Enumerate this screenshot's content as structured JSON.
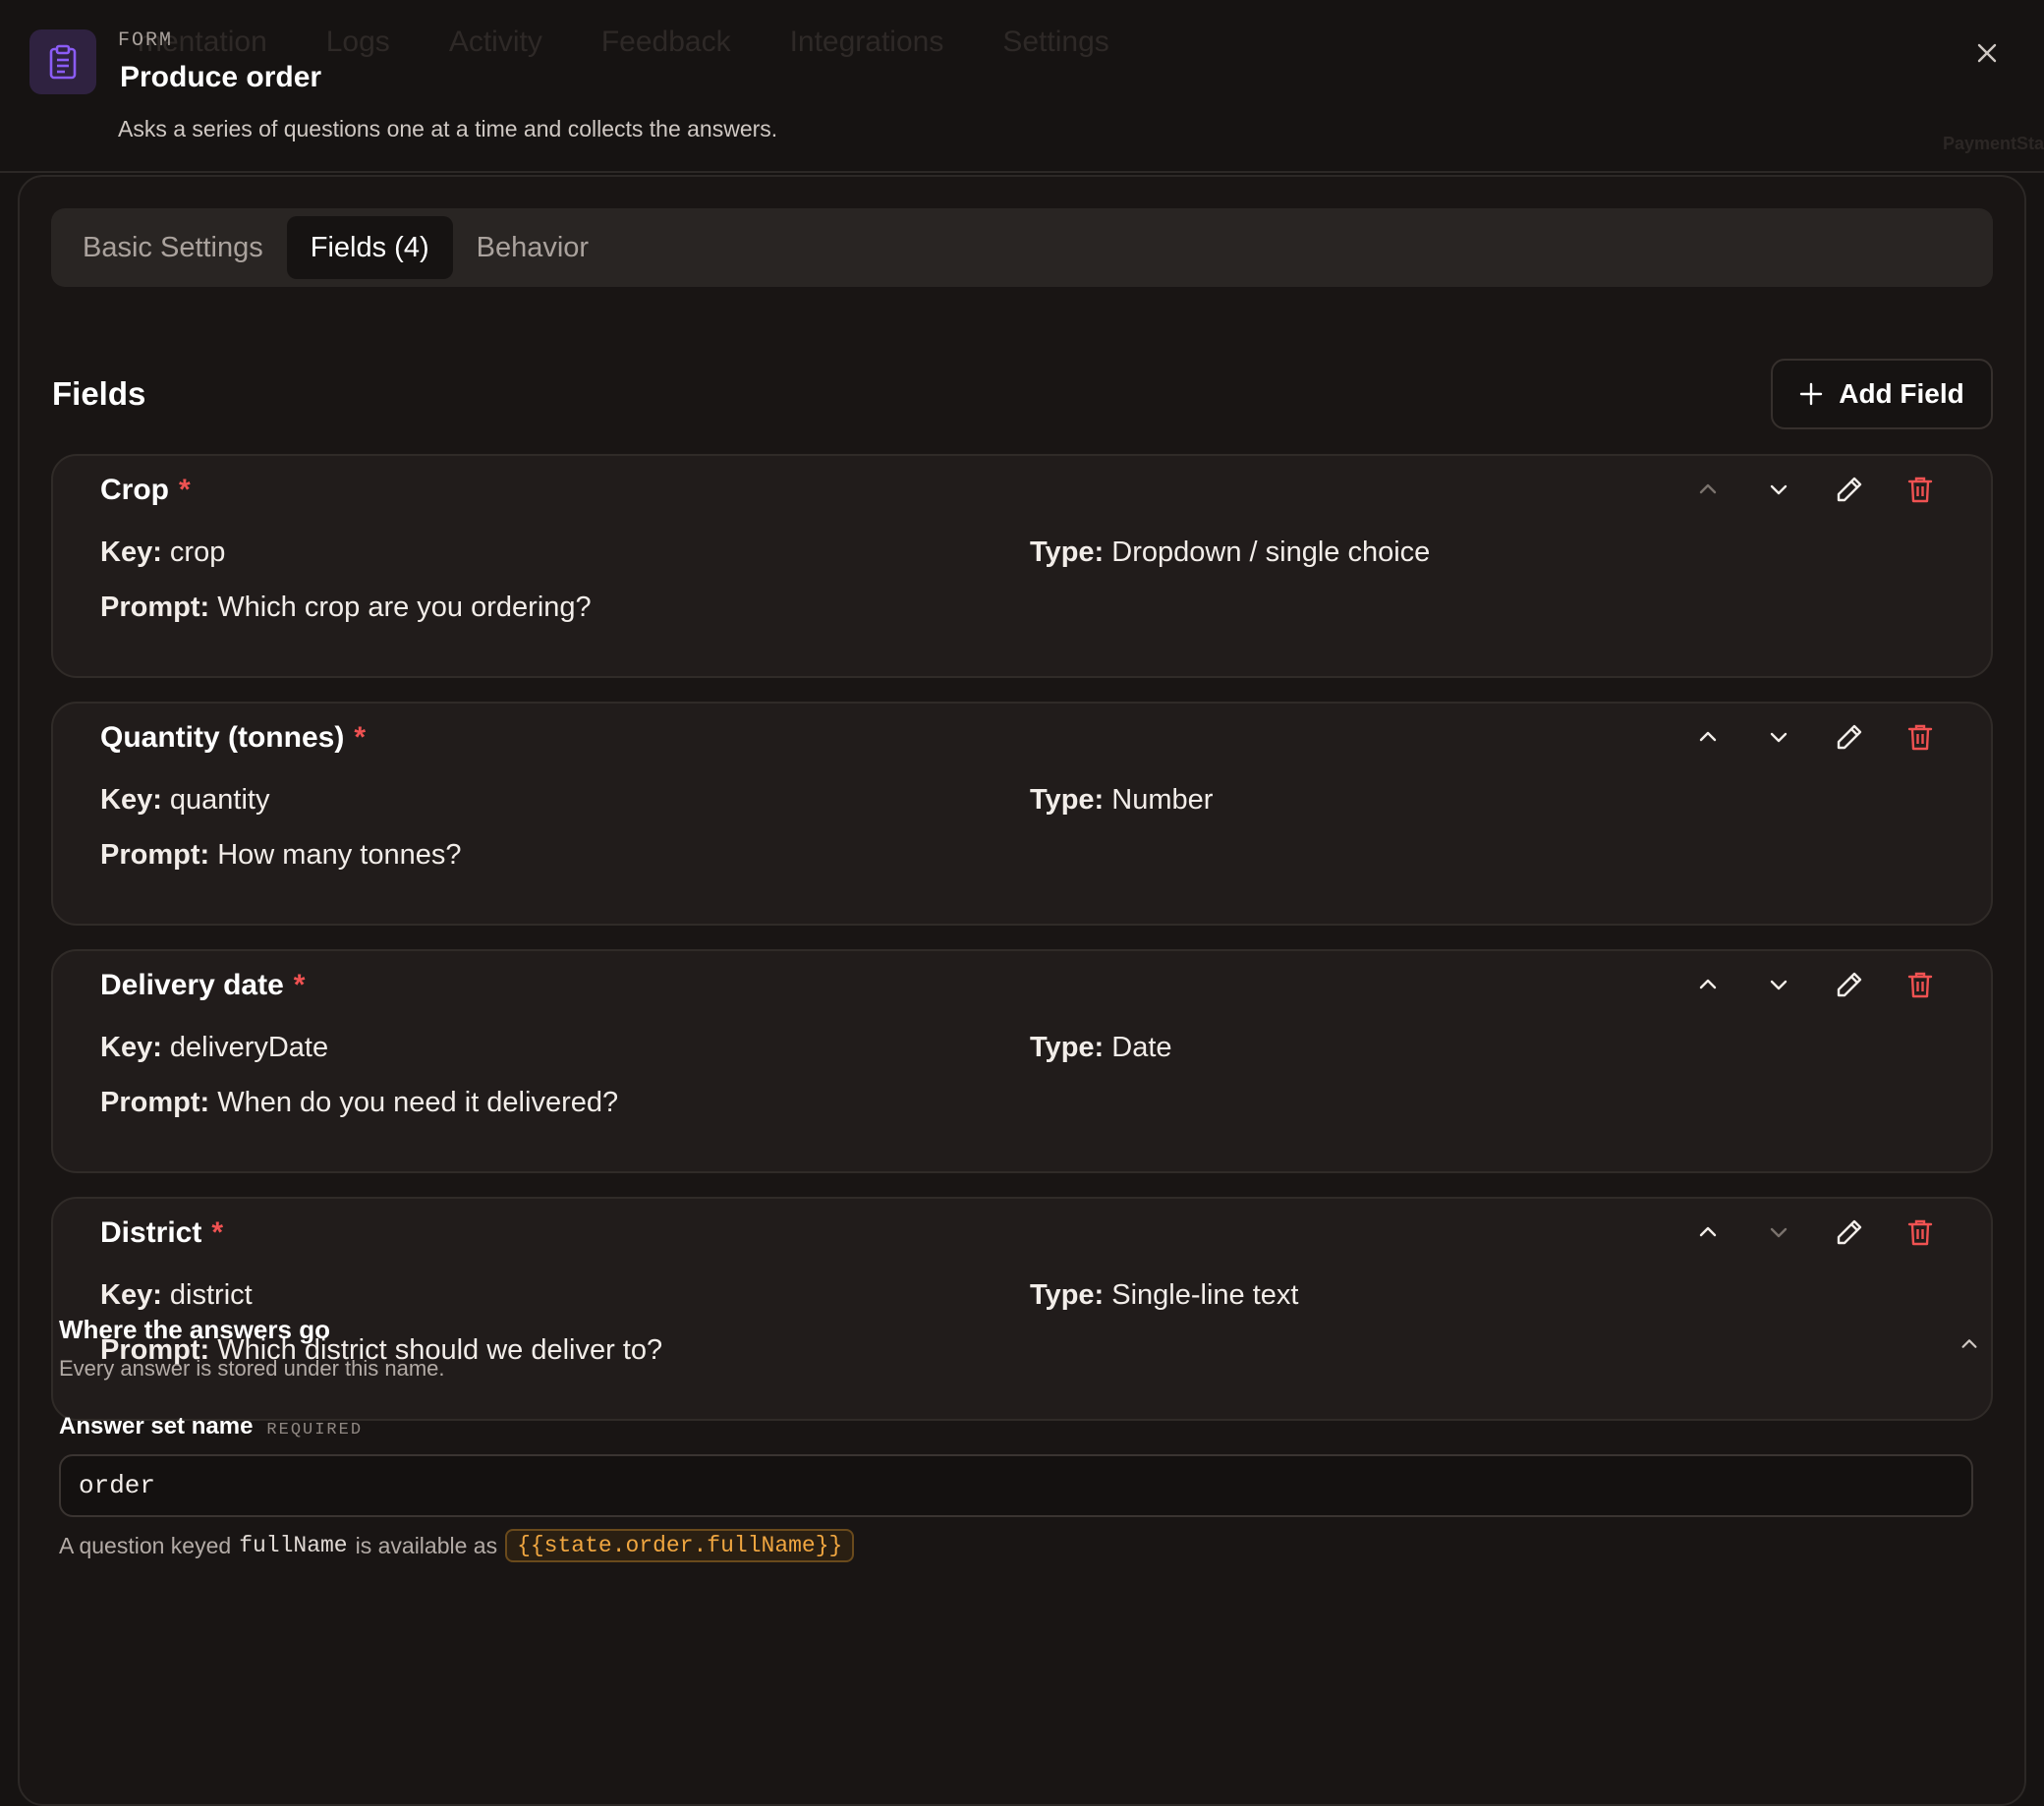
{
  "background_nav": {
    "items": [
      "mentation",
      "Logs",
      "Activity",
      "Feedback",
      "Integrations",
      "Settings"
    ],
    "right_text": "PaymentSta"
  },
  "header": {
    "kind": "FORM",
    "title": "Produce order",
    "description": "Asks a series of questions one at a time and collects the answers.",
    "icon": "clipboard-icon"
  },
  "tabs": [
    {
      "label": "Basic Settings",
      "active": false
    },
    {
      "label": "Fields (4)",
      "active": true
    },
    {
      "label": "Behavior",
      "active": false
    }
  ],
  "fields_section": {
    "title": "Fields",
    "add_button_label": "Add Field",
    "key_label": "Key:",
    "type_label": "Type:",
    "prompt_label": "Prompt:",
    "required_marker": "*"
  },
  "fields": [
    {
      "label": "Crop",
      "key": "crop",
      "type": "Dropdown / single choice",
      "prompt": "Which crop are you ordering?",
      "up_enabled": false,
      "down_enabled": true
    },
    {
      "label": "Quantity (tonnes)",
      "key": "quantity",
      "type": "Number",
      "prompt": "How many tonnes?",
      "up_enabled": true,
      "down_enabled": true
    },
    {
      "label": "Delivery date",
      "key": "deliveryDate",
      "type": "Date",
      "prompt": "When do you need it delivered?",
      "up_enabled": true,
      "down_enabled": true
    },
    {
      "label": "District",
      "key": "district",
      "type": "Single-line text",
      "prompt": "Which district should we deliver to?",
      "up_enabled": true,
      "down_enabled": false
    }
  ],
  "answers": {
    "title": "Where the answers go",
    "subtitle": "Every answer is stored under this name.",
    "field_label": "Answer set name",
    "required_tag": "REQUIRED",
    "value": "order",
    "hint_prefix": "A question keyed",
    "hint_key": "fullName",
    "hint_middle": "is available as",
    "hint_token": "{{state.order.fullName}}"
  },
  "colors": {
    "accent_purple": "#8b5cf6",
    "danger_red": "#f05252",
    "token_orange": "#f0a640"
  }
}
